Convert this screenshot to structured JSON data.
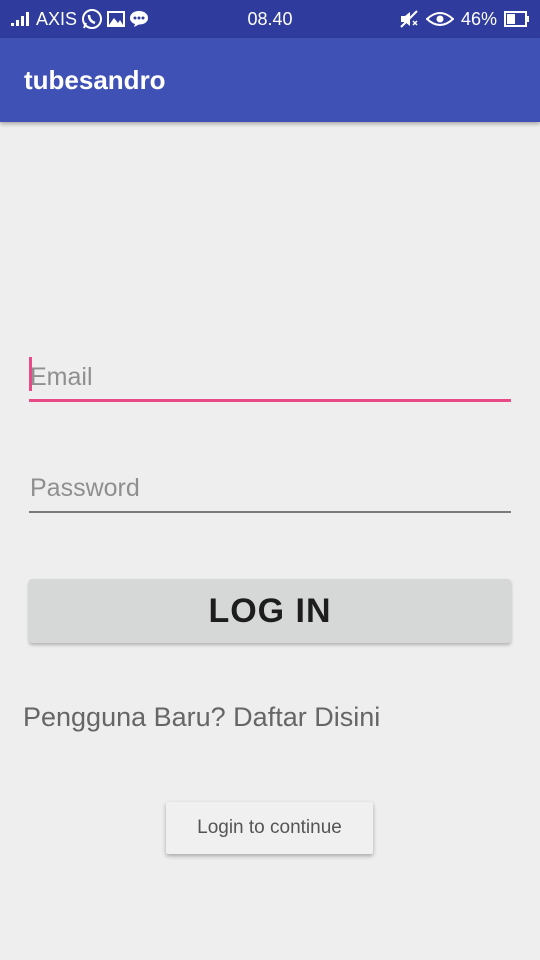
{
  "status_bar": {
    "carrier": "AXIS",
    "time": "08.40",
    "battery": "46%",
    "icons": [
      "signal-icon",
      "whatsapp-icon",
      "gallery-icon",
      "message-icon",
      "mute-icon",
      "eye-icon",
      "battery-icon"
    ]
  },
  "app_bar": {
    "title": "tubesandro"
  },
  "form": {
    "email_placeholder": "Email",
    "password_placeholder": "Password",
    "login_label": "LOG IN",
    "register_text": "Pengguna Baru? Daftar Disini",
    "continue_label": "Login to continue"
  },
  "colors": {
    "status_bar": "#2f3c9e",
    "app_bar": "#3f51b5",
    "accent": "#e84a87",
    "background": "#eeeeee"
  }
}
